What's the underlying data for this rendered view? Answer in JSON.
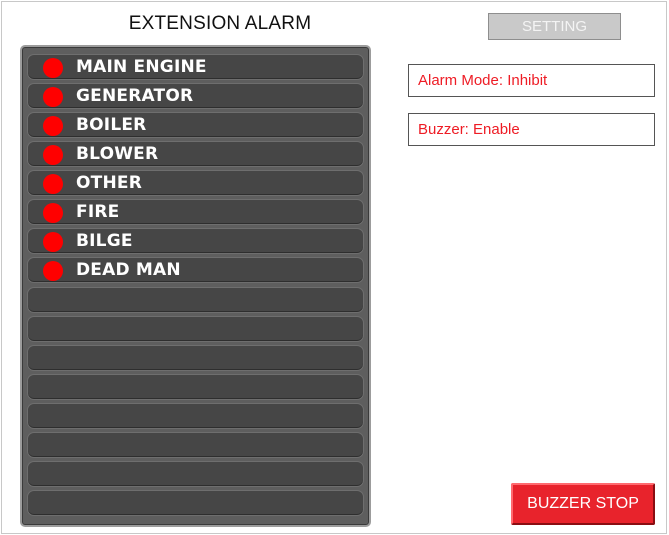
{
  "header": {
    "title": "EXTENSION ALARM",
    "setting_label": "SETTING"
  },
  "alarms": [
    {
      "label": "MAIN ENGINE",
      "active": true
    },
    {
      "label": "GENERATOR",
      "active": true
    },
    {
      "label": "BOILER",
      "active": true
    },
    {
      "label": "BLOWER",
      "active": true
    },
    {
      "label": "OTHER",
      "active": true
    },
    {
      "label": "FIRE",
      "active": true
    },
    {
      "label": "BILGE",
      "active": true
    },
    {
      "label": "DEAD MAN",
      "active": true
    },
    {
      "label": "",
      "active": false
    },
    {
      "label": "",
      "active": false
    },
    {
      "label": "",
      "active": false
    },
    {
      "label": "",
      "active": false
    },
    {
      "label": "",
      "active": false
    },
    {
      "label": "",
      "active": false
    },
    {
      "label": "",
      "active": false
    },
    {
      "label": "",
      "active": false
    }
  ],
  "status": {
    "alarm_mode": "Alarm Mode: Inhibit",
    "buzzer": "Buzzer: Enable"
  },
  "buzzer_stop_label": "BUZZER STOP",
  "colors": {
    "alarm_lamp": "#ff0000",
    "status_text": "#ee1c25",
    "buzzer_stop_button": "#e8232c",
    "setting_button": "#c9c9c9",
    "panel_background": "#5e5e5e",
    "row_background": "#464646"
  }
}
